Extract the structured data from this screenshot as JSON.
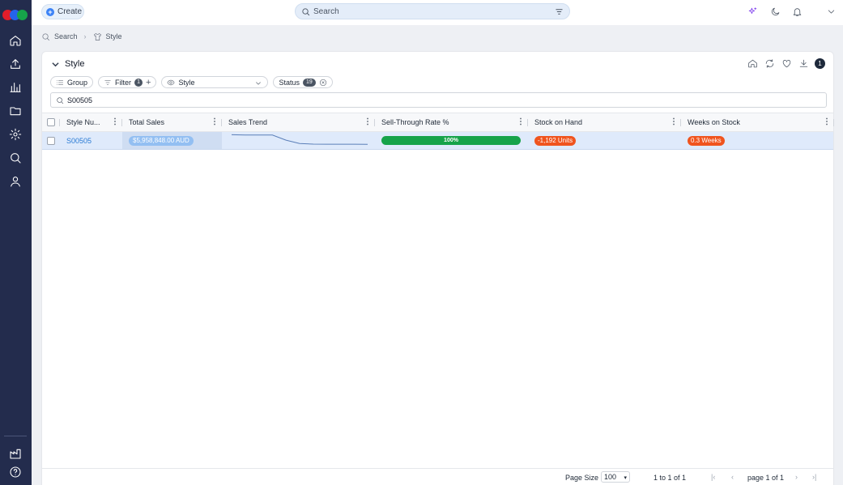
{
  "colors": {
    "sidebar_bg": "#232c4d",
    "accent": "#3b82f6",
    "row_selected": "#dfeafb",
    "progress_green": "#16a34a",
    "negative_orange": "#f0541e",
    "logo": [
      "#e11d2a",
      "#2563eb",
      "#16a34a"
    ]
  },
  "sidebar": {
    "items": [
      {
        "icon": "home-icon"
      },
      {
        "icon": "upload-icon"
      },
      {
        "icon": "bar-chart-icon"
      },
      {
        "icon": "folder-icon"
      },
      {
        "icon": "gear-icon"
      },
      {
        "icon": "search-icon"
      },
      {
        "icon": "user-icon"
      }
    ],
    "bottom_items": [
      {
        "icon": "factory-icon"
      },
      {
        "icon": "help-icon"
      }
    ]
  },
  "topbar": {
    "create_label": "Create",
    "search_placeholder": "Search",
    "icons": [
      "sparkle-icon",
      "moon-icon",
      "bell-icon",
      "chevron-down-icon"
    ]
  },
  "breadcrumb": {
    "items": [
      "Search",
      "Style"
    ]
  },
  "panel": {
    "title": "Style",
    "tool_icons": [
      "home-icon",
      "refresh-icon",
      "heart-icon",
      "download-icon"
    ],
    "notification_count": "1",
    "chips": {
      "group_label": "Group",
      "filter_label": "Filter",
      "filter_count": "1",
      "style_label": "Style",
      "status_label": "Status",
      "status_count": "19"
    },
    "search_value": "S00505"
  },
  "grid": {
    "columns": [
      "Style Nu...",
      "Total Sales",
      "Sales Trend",
      "Sell-Through Rate %",
      "Stock on Hand",
      "Weeks on Stock"
    ],
    "rows": [
      {
        "style_number": "S00505",
        "total_sales": "$5,958,848.00 AUD",
        "sales_trend": [
          0.92,
          0.9,
          0.9,
          0.9,
          0.55,
          0.32,
          0.28,
          0.27,
          0.27,
          0.27,
          0.26
        ],
        "sell_through": "100%",
        "sell_through_value": 1.0,
        "stock_on_hand": "-1,192 Units",
        "weeks_on_stock": "0.3 Weeks"
      }
    ]
  },
  "footer": {
    "page_size_label": "Page Size",
    "page_size": "100",
    "range_text": "1 to 1 of 1",
    "page_text": "page 1 of 1"
  }
}
